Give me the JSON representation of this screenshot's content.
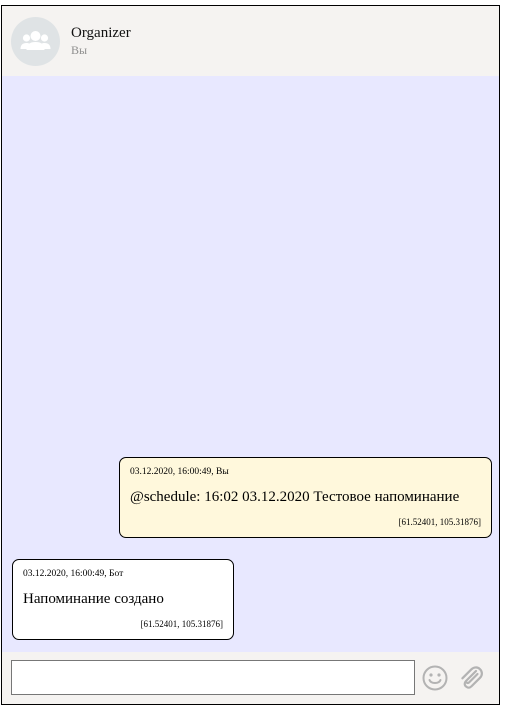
{
  "header": {
    "title": "Organizer",
    "subtitle": "Вы",
    "avatar_icon": "group-icon"
  },
  "messages": [
    {
      "direction": "outgoing",
      "meta": "03.12.2020, 16:00:49, Вы",
      "text": "@schedule: 16:02 03.12.2020 Тестовое напоминание",
      "coords": "[61.52401, 105.31876]"
    },
    {
      "direction": "incoming",
      "meta": "03.12.2020, 16:00:49, Бот",
      "text": "Напоминание создано",
      "coords": "[61.52401, 105.31876]"
    }
  ],
  "composer": {
    "value": "",
    "placeholder": "",
    "emoji_icon": "emoji-icon",
    "attach_icon": "paperclip-icon"
  },
  "colors": {
    "chat_background": "#e8e8ff",
    "header_background": "#f5f3f1",
    "outgoing_bubble": "#fff8dc",
    "incoming_bubble": "#ffffff",
    "icon_gray": "#b3b3b3"
  }
}
